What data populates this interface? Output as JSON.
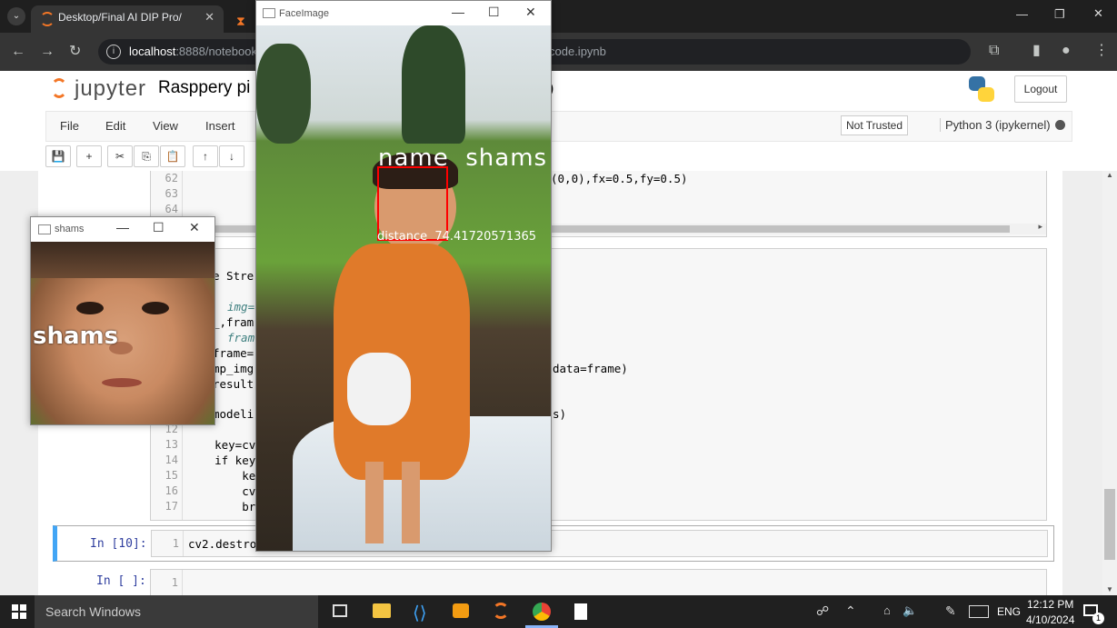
{
  "browser": {
    "tab1_title": "Desktop/Final AI DIP Pro/",
    "url_host": "localhost",
    "url_path": ":8888/notebook",
    "url_tail": "code.ipynb",
    "tab_close": "✕"
  },
  "jupyter": {
    "logo_text": "jupyter",
    "notebook_title": "Rasppery pi",
    "title_paren": ")",
    "logout_label": "Logout",
    "menu": [
      "File",
      "Edit",
      "View",
      "Insert"
    ],
    "not_trusted": "Not Trusted",
    "kernel": "Python 3 (ipykernel)"
  },
  "cell_top": {
    "lines": [
      {
        "num": "62",
        "code": "(0,0),fx=0.5,fy=0.5)"
      },
      {
        "num": "63",
        "code": ""
      },
      {
        "num": "64",
        "code": ""
      }
    ]
  },
  "cell_main": {
    "frag": [
      {
        "text": "e Stre"
      },
      {
        "text": "img="
      },
      {
        "text": "_,fram"
      },
      {
        "text": "fram"
      },
      {
        "text": "frame="
      },
      {
        "text": "mp_img"
      },
      {
        "text": "result"
      },
      {
        "text": "modeli"
      },
      {
        "text": "data=frame)"
      },
      {
        "text": "s)"
      }
    ],
    "lines": [
      {
        "num": "12",
        "code": ""
      },
      {
        "num": "13",
        "code": "    key=cv"
      },
      {
        "num": "14",
        "code": "    if key"
      },
      {
        "num": "15",
        "code": "        ke"
      },
      {
        "num": "16",
        "code": "        cv"
      },
      {
        "num": "17",
        "code": "        br"
      }
    ]
  },
  "cell10": {
    "prompt": "In [10]:",
    "num": "1",
    "code": "cv2.destro"
  },
  "cell_empty": {
    "prompt": "In [ ]:",
    "num": "1"
  },
  "win_face": {
    "title": "FaceImage",
    "label_name": "name  shams",
    "label_distance": "distance  74.41720571365"
  },
  "win_shams": {
    "title": "shams",
    "label": "shams"
  },
  "taskbar": {
    "search_placeholder": "Search Windows",
    "lang": "ENG",
    "time": "12:12 PM",
    "date": "4/10/2024",
    "notif_count": "1"
  },
  "colors": {
    "accent_jupyter": "#f37626",
    "face_box": "#ff0000"
  }
}
